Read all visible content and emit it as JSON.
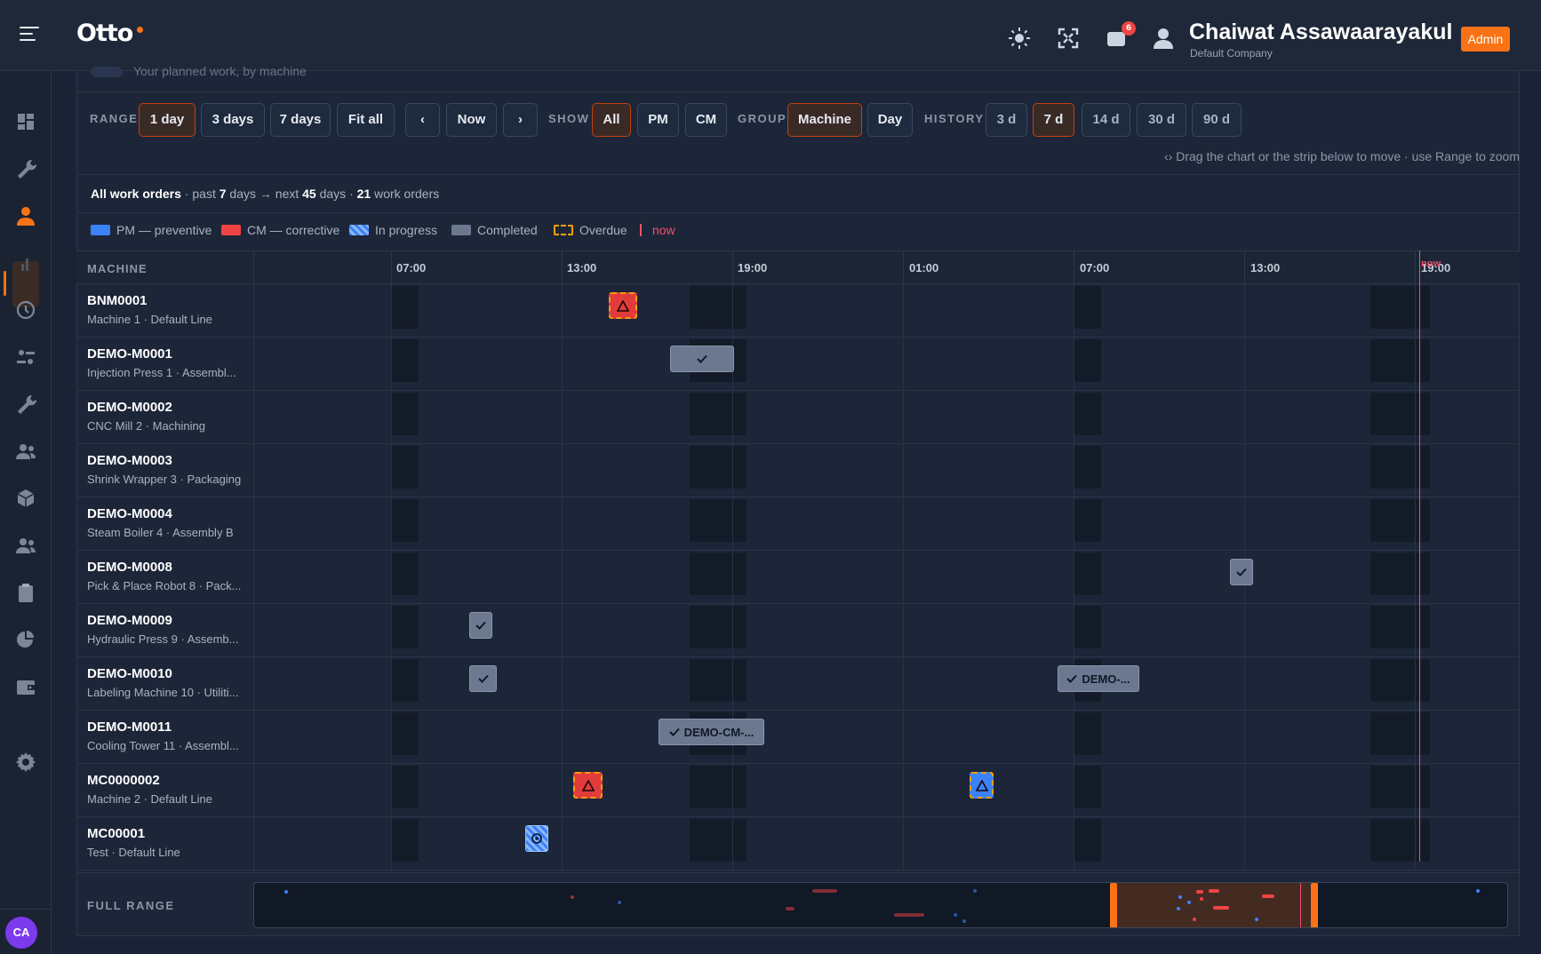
{
  "app": {
    "logo": "Otto"
  },
  "header": {
    "notifications_count": "6",
    "user_name": "Chaiwat Assawaarayakul",
    "user_company": "Default Company",
    "role_badge": "Admin",
    "icons": [
      "sun-icon",
      "fullscreen-icon",
      "notification-icon",
      "user-icon"
    ]
  },
  "sidebar": {
    "items": [
      {
        "icon": "dashboard-icon"
      },
      {
        "icon": "wrench-icon"
      },
      {
        "icon": "person-icon",
        "active": true
      },
      {
        "icon": "bar-chart-icon"
      },
      {
        "icon": "history-icon"
      },
      {
        "icon": "sliders-icon"
      },
      {
        "icon": "tool-icon"
      },
      {
        "icon": "team-icon"
      },
      {
        "icon": "box-icon"
      },
      {
        "icon": "users-icon"
      },
      {
        "icon": "clipboard-icon"
      },
      {
        "icon": "pie-chart-icon"
      },
      {
        "icon": "wallet-icon"
      },
      {
        "icon": "gear-icon"
      }
    ],
    "avatar_initials": "CA"
  },
  "page": {
    "subtitle": "Your planned work, by machine"
  },
  "controls": {
    "range_label": "RANGE",
    "range_buttons": [
      "1 day",
      "3 days",
      "7 days",
      "Fit all"
    ],
    "range_active": "1 day",
    "prev": "‹",
    "now": "Now",
    "next": "›",
    "show_label": "SHOW",
    "show_buttons": [
      "All",
      "PM",
      "CM"
    ],
    "show_active": "All",
    "group_label": "GROUP",
    "group_buttons": [
      "Machine",
      "Day"
    ],
    "group_active": "Machine",
    "history_label": "HISTORY",
    "history_buttons": [
      "3 d",
      "7 d",
      "14 d",
      "30 d",
      "90 d"
    ],
    "history_active": "7 d",
    "drag_hint": "Drag the chart or the strip below to move · use Range to zoom"
  },
  "summary": {
    "scope": "All work orders",
    "past_prefix": "past",
    "past_days": "7",
    "past_unit": "days →",
    "next_prefix": "next",
    "next_days": "45",
    "next_unit": "days ·",
    "count": "21",
    "count_unit": "work orders"
  },
  "legend": {
    "pm": "PM — preventive",
    "cm": "CM — corrective",
    "in_progress": "In progress",
    "completed": "Completed",
    "overdue": "Overdue",
    "now": "now",
    "colors": {
      "pm": "#3b82f6",
      "cm": "#ef4444",
      "completed": "#6b7890",
      "overdue": "#f59e0b",
      "now": "#f0506e"
    }
  },
  "timeline": {
    "column_header": "MACHINE",
    "time_labels": [
      "07:00",
      "13:00",
      "19:00",
      "01:00",
      "07:00",
      "13:00",
      "19:00"
    ],
    "now_label": "now"
  },
  "machines": [
    {
      "code": "BNM0001",
      "sub": "Machine 1 · Default Line",
      "orders": [
        {
          "kind": "cm-overdue",
          "icon": "warning-icon",
          "label": ""
        }
      ]
    },
    {
      "code": "DEMO-M0001",
      "sub": "Injection Press 1 · Assembl...",
      "orders": [
        {
          "kind": "completed",
          "icon": "check-icon",
          "label": ""
        }
      ]
    },
    {
      "code": "DEMO-M0002",
      "sub": "CNC Mill 2 · Machining",
      "orders": []
    },
    {
      "code": "DEMO-M0003",
      "sub": "Shrink Wrapper 3 · Packaging",
      "orders": []
    },
    {
      "code": "DEMO-M0004",
      "sub": "Steam Boiler 4 · Assembly B",
      "orders": []
    },
    {
      "code": "DEMO-M0008",
      "sub": "Pick & Place Robot 8 · Pack...",
      "orders": [
        {
          "kind": "completed",
          "icon": "check-icon",
          "label": ""
        }
      ]
    },
    {
      "code": "DEMO-M0009",
      "sub": "Hydraulic Press 9 · Assemb...",
      "orders": [
        {
          "kind": "completed",
          "icon": "check-icon",
          "label": ""
        }
      ]
    },
    {
      "code": "DEMO-M0010",
      "sub": "Labeling Machine 10 · Utiliti...",
      "orders": [
        {
          "kind": "completed",
          "icon": "check-icon",
          "label": ""
        },
        {
          "kind": "completed",
          "icon": "check-icon",
          "label": "DEMO-..."
        }
      ]
    },
    {
      "code": "DEMO-M0011",
      "sub": "Cooling Tower 11 · Assembl...",
      "orders": [
        {
          "kind": "completed",
          "icon": "check-icon",
          "label": "DEMO-CM-..."
        }
      ]
    },
    {
      "code": "MC0000002",
      "sub": "Machine 2 · Default Line",
      "orders": [
        {
          "kind": "cm-overdue",
          "icon": "warning-icon",
          "label": ""
        },
        {
          "kind": "pm-overdue",
          "icon": "warning-icon",
          "label": ""
        }
      ]
    },
    {
      "code": "MC00001",
      "sub": "Test · Default Line",
      "orders": [
        {
          "kind": "inprog",
          "icon": "progress-icon",
          "label": ""
        }
      ]
    }
  ],
  "full_range": {
    "label": "FULL RANGE"
  }
}
